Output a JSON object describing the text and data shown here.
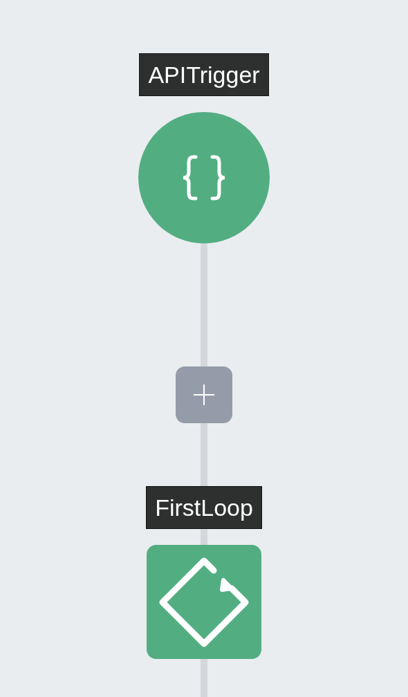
{
  "steps": [
    {
      "kind": "trigger",
      "label": "APITrigger"
    },
    {
      "kind": "add"
    },
    {
      "kind": "loop",
      "label": "FirstLoop"
    }
  ]
}
